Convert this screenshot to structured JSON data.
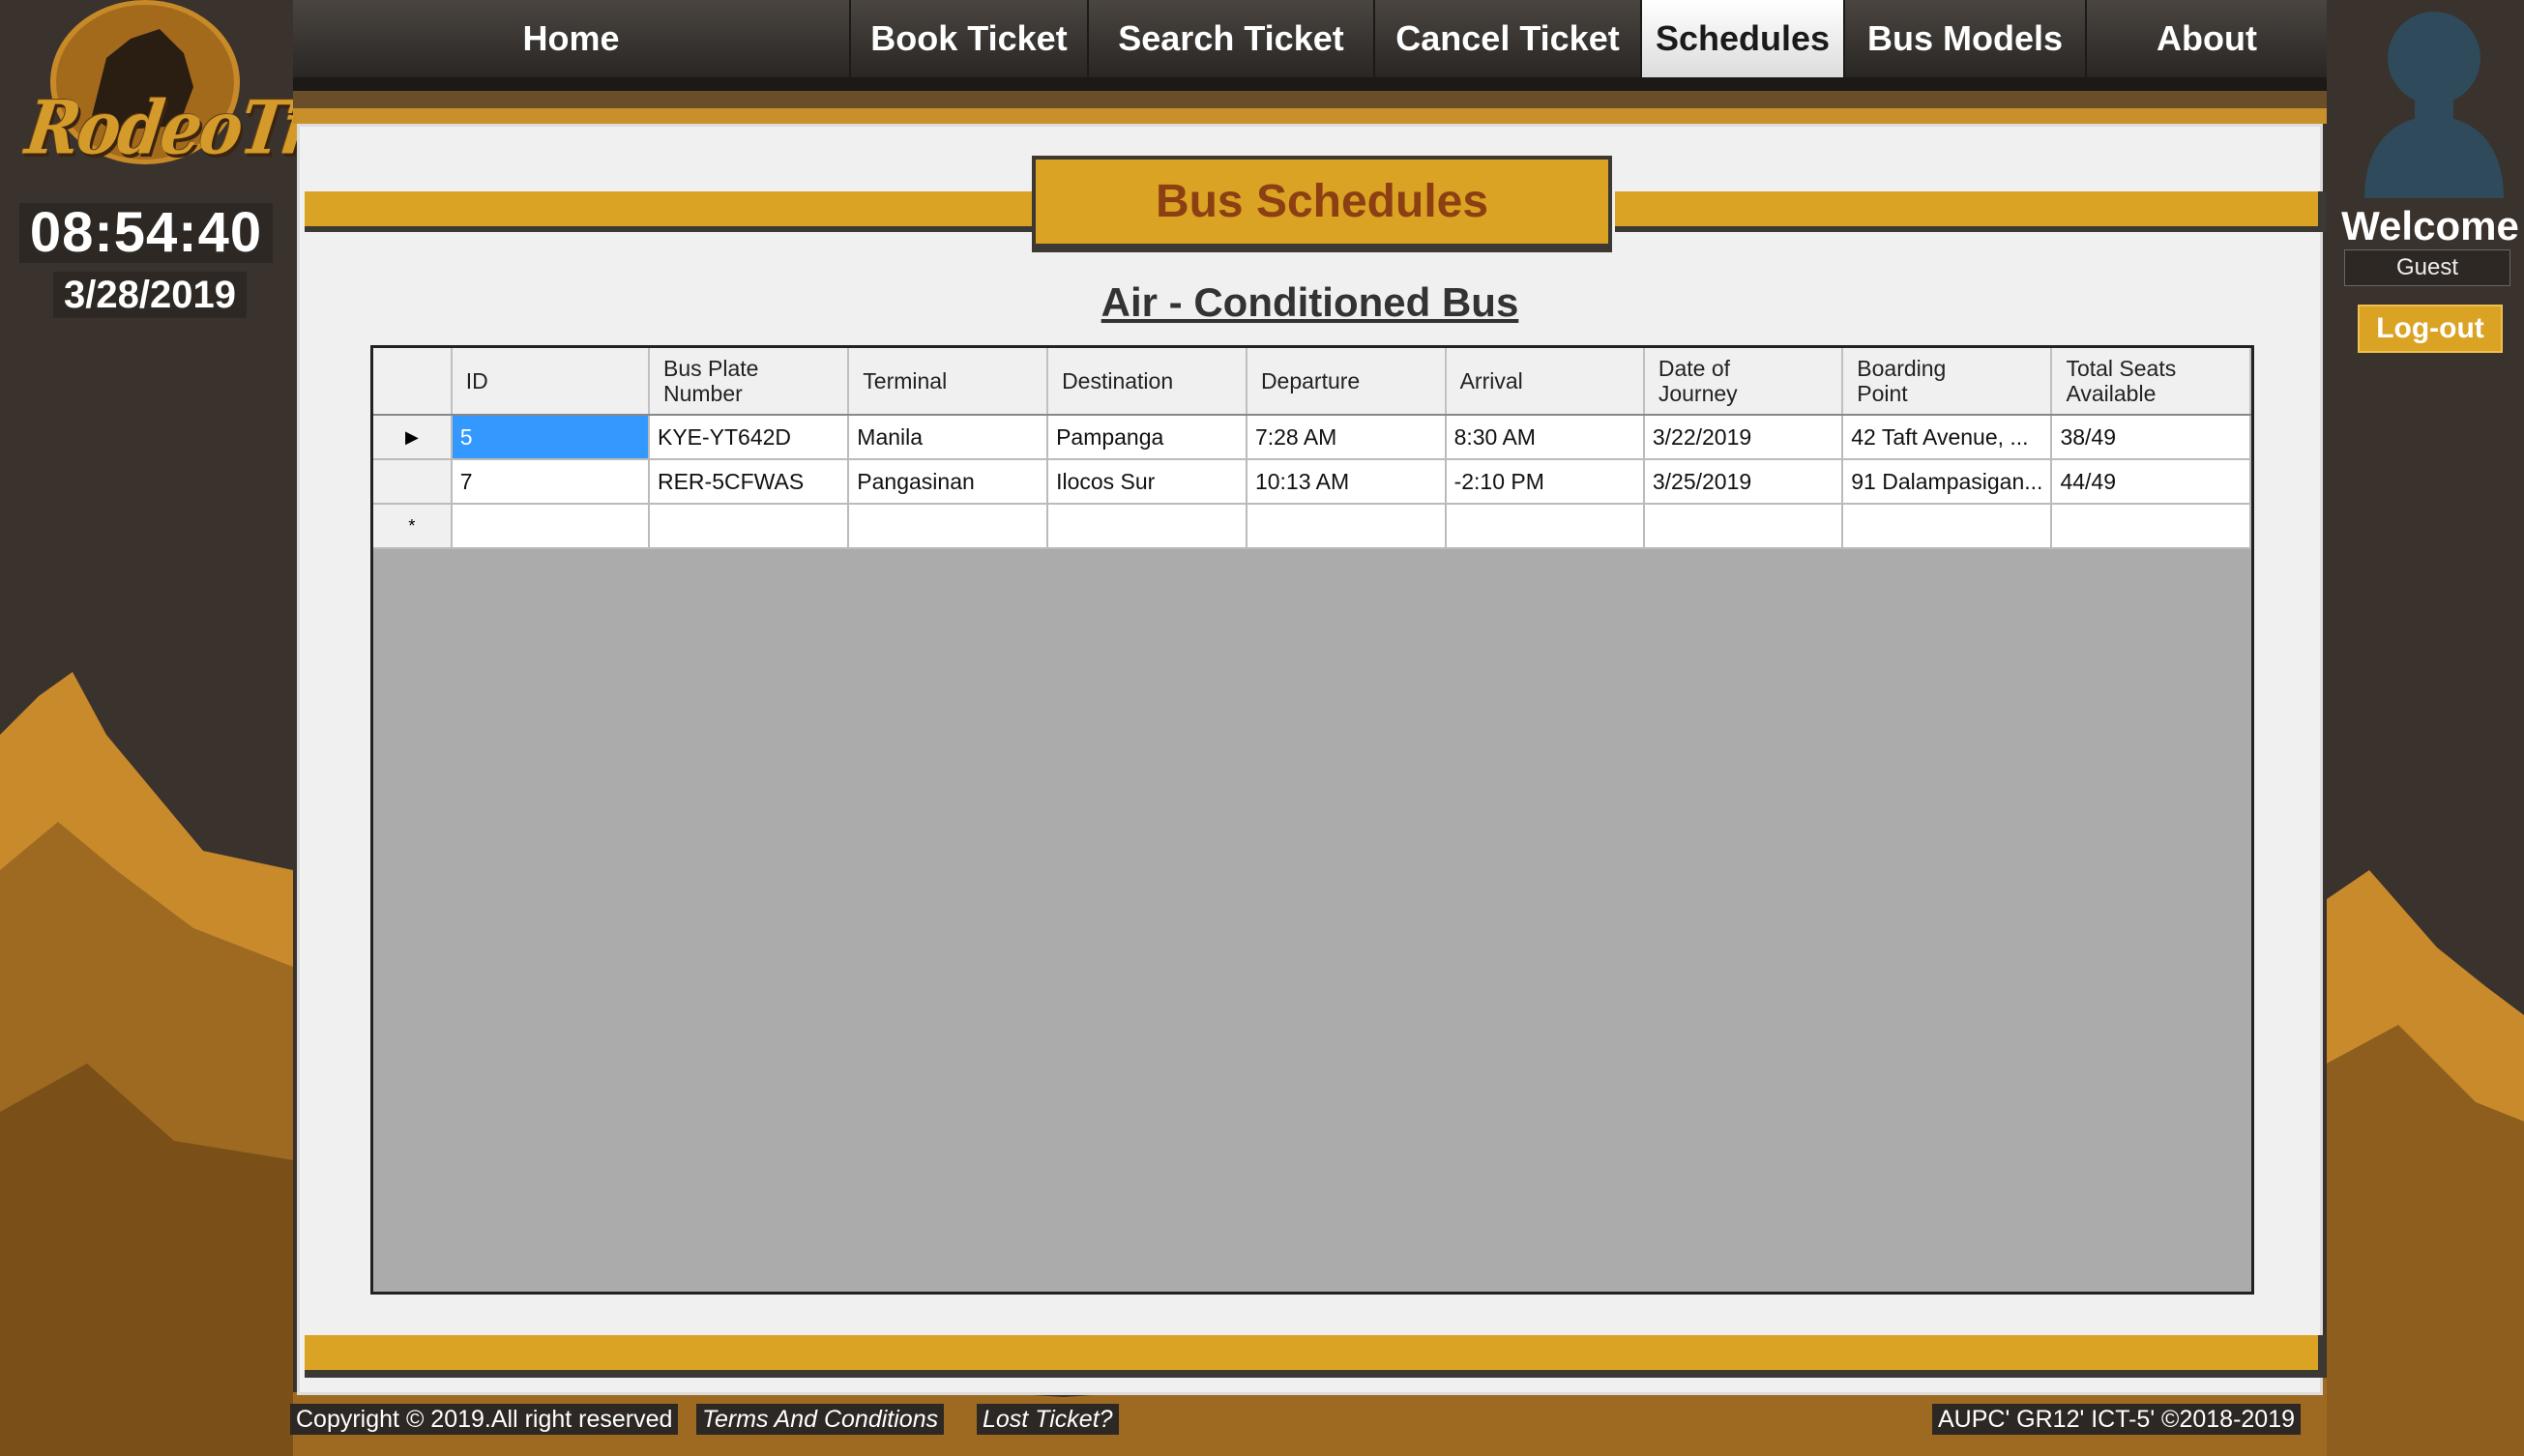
{
  "app": {
    "logo_text": "RodeoTrip",
    "clock": "08:54:40",
    "date": "3/28/2019"
  },
  "nav": {
    "items": [
      {
        "label": "Home",
        "active": false
      },
      {
        "label": "Book Ticket",
        "active": false
      },
      {
        "label": "Search Ticket",
        "active": false
      },
      {
        "label": "Cancel Ticket",
        "active": false
      },
      {
        "label": "Schedules",
        "active": true
      },
      {
        "label": "Bus Models",
        "active": false
      },
      {
        "label": "About",
        "active": false
      }
    ]
  },
  "main": {
    "title": "Bus Schedules",
    "subtitle": "Air - Conditioned Bus"
  },
  "grid": {
    "columns": [
      "ID",
      "Bus Plate\nNumber",
      "Terminal",
      "Destination",
      "Departure",
      "Arrival",
      "Date of\nJourney",
      "Boarding\nPoint",
      "Total Seats\nAvailable"
    ],
    "rows": [
      [
        "5",
        "KYE-YT642D",
        "Manila",
        "Pampanga",
        "7:28 AM",
        "8:30 AM",
        "3/22/2019",
        "42 Taft Avenue, ...",
        "38/49"
      ],
      [
        "7",
        "RER-5CFWAS",
        "Pangasinan",
        "Ilocos Sur",
        "10:13 AM",
        "-2:10 PM",
        "3/25/2019",
        "91 Dalampasigan...",
        "44/49"
      ]
    ],
    "current_row_marker": "▶",
    "new_row_marker": "*"
  },
  "footer": {
    "copyright": "Copyright © 2019.All right reserved",
    "terms": "Terms And Conditions",
    "lost_ticket": "Lost Ticket?",
    "credits": "AUPC' GR12'  ICT-5'  ©2018-2019"
  },
  "user": {
    "welcome": "Welcome",
    "name": "Guest",
    "logout": "Log-out"
  },
  "colors": {
    "accent_gold": "#dba323",
    "title_text": "#8b3f12",
    "selection": "#3399ff",
    "dark_bg": "#3a322c"
  }
}
